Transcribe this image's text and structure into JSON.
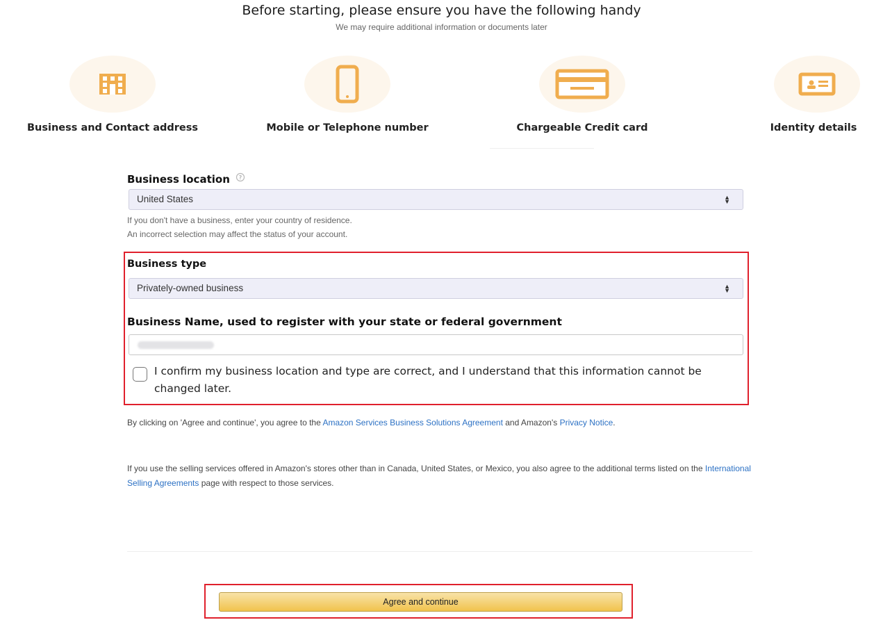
{
  "header": {
    "title": "Before starting, please ensure you have the following handy",
    "subtitle": "We may require additional information or documents later"
  },
  "requirements": [
    {
      "icon": "building-icon",
      "label": "Business and Contact address"
    },
    {
      "icon": "mobile-phone-icon",
      "label": "Mobile or Telephone number"
    },
    {
      "icon": "credit-card-icon",
      "label": "Chargeable Credit card"
    },
    {
      "icon": "id-card-icon",
      "label": "Identity details"
    }
  ],
  "form": {
    "location": {
      "label": "Business location",
      "value": "United States",
      "hint_1": "If you don't have a business, enter your country of residence.",
      "hint_2": "An incorrect selection may affect the status of your account."
    },
    "type": {
      "label": "Business type",
      "value": "Privately-owned business"
    },
    "name": {
      "label": "Business Name, used to register with your state or federal government"
    },
    "confirm": {
      "text": "I confirm my business location and type are correct, and I understand that this information cannot be changed later.",
      "checked": false
    }
  },
  "legal": {
    "p1_a": "By clicking on 'Agree and continue', you agree to the ",
    "p1_link": "Amazon Services Business Solutions Agreement",
    "p1_b": " and Amazon's ",
    "p1_link2": "Privacy Notice",
    "p1_c": ".",
    "p2_a": "If you use the selling services offered in Amazon's stores other than in Canada, United States, or Mexico, you also agree to the additional terms listed on the ",
    "p2_link": "International Selling Agreements",
    "p2_b": " page with respect to those services."
  },
  "actions": {
    "agree_label": "Agree and continue"
  },
  "colors": {
    "accent": "#f0ad4e",
    "highlight": "#e0202c",
    "link": "#2c71c4",
    "button": "#f1c34d"
  }
}
